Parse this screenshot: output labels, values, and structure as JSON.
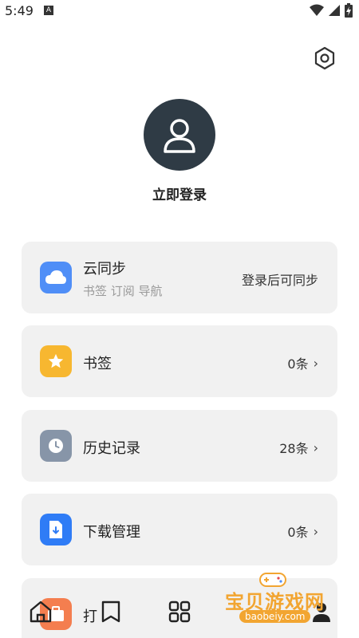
{
  "status": {
    "time": "5:49",
    "notif_letter": "A"
  },
  "profile": {
    "login_label": "立即登录"
  },
  "cards": [
    {
      "id": "cloud-sync",
      "title": "云同步",
      "subtitle": "书签 订阅 导航",
      "right": "登录后可同步",
      "icon": "cloud-icon",
      "color": "#4f8ef7"
    },
    {
      "id": "bookmarks",
      "title": "书签",
      "right": "0条",
      "icon": "star-icon",
      "color": "#f7b730"
    },
    {
      "id": "history",
      "title": "历史记录",
      "right": "28条",
      "icon": "clock-icon",
      "color": "#8795a8"
    },
    {
      "id": "downloads",
      "title": "下载管理",
      "right": "0条",
      "icon": "download-file-icon",
      "color": "#2f7cf6"
    },
    {
      "id": "more",
      "title": "打",
      "icon": "briefcase-icon",
      "color": "#f47e4f"
    }
  ],
  "bottom_nav": [
    "home-icon",
    "bookmark-icon",
    "apps-grid-icon",
    "profile-icon"
  ],
  "watermark": {
    "title": "宝贝游戏网",
    "url": "baobeiy.com"
  }
}
